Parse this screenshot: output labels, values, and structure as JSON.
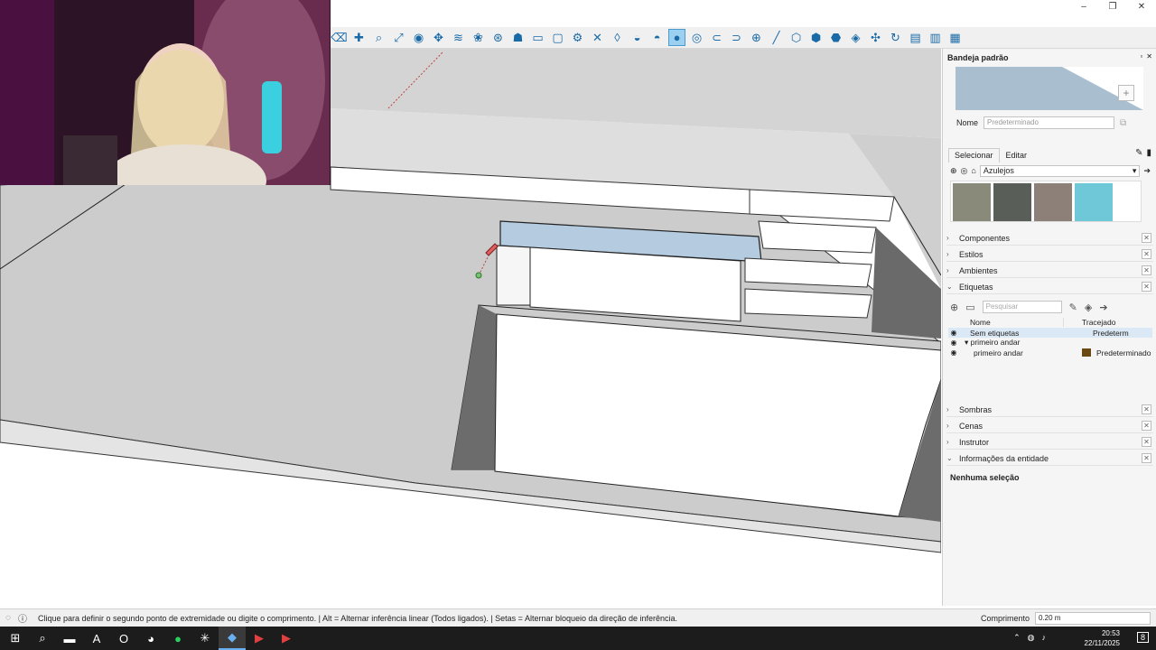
{
  "window": {
    "controls": [
      "–",
      "❐",
      "✕"
    ]
  },
  "toolbar": {
    "tools": [
      "eraser-icon",
      "paint-icon",
      "zoom-icon",
      "zoom-extents-icon",
      "orbit-icon",
      "pan-icon",
      "walk-icon",
      "look-icon",
      "section-icon",
      "component-icon",
      "select-icon",
      "rectangle-icon",
      "settings-icon",
      "close-icon",
      "fog-icon",
      "water-icon",
      "shadow-icon",
      "drop-icon",
      "style-icon",
      "magnet-icon",
      "magnet-active-icon",
      "add-icon",
      "line-icon",
      "cube-icon",
      "cube2-icon",
      "cube3-icon",
      "cube4-icon",
      "move-icon",
      "rotate-icon",
      "layer-icon",
      "layer2-icon",
      "layer3-icon"
    ],
    "active_tool": "drop-icon"
  },
  "panel": {
    "title": "Bandeja padrão",
    "name_label": "Nome",
    "name_placeholder": "Predeterminado",
    "tabs": [
      "Selecionar",
      "Editar"
    ],
    "library": "Azulejos",
    "swatches": [
      "#8a8a7a",
      "#5a5e58",
      "#8c8078",
      "#6fc8d8"
    ],
    "sections": [
      {
        "label": "Componentes",
        "expanded": false
      },
      {
        "label": "Estilos",
        "expanded": false
      },
      {
        "label": "Ambientes",
        "expanded": false
      },
      {
        "label": "Etiquetas",
        "expanded": true
      }
    ],
    "tags": {
      "search_placeholder": "Pesquisar",
      "col_name": "Nome",
      "col_dash": "Tracejado",
      "rows": [
        {
          "name": "Sem etiquetas",
          "dash": "Predeterm",
          "selected": true
        },
        {
          "name": "▾ primeiro andar",
          "dash": "",
          "selected": false
        },
        {
          "name": "primeiro andar",
          "dash": "Predeterminado",
          "selected": false
        }
      ]
    },
    "lower_sections": [
      {
        "label": "Sombras",
        "expanded": false
      },
      {
        "label": "Cenas",
        "expanded": false
      },
      {
        "label": "Instrutor",
        "expanded": false
      },
      {
        "label": "Informações da entidade",
        "expanded": true
      }
    ],
    "entity_info": "Nenhuma seleção"
  },
  "status": {
    "hint": "Clique para definir o segundo ponto de extremidade ou digite o comprimento. | Alt = Alternar inferência linear (Todos ligados). | Setas = Alternar bloqueio da direção de inferência.",
    "measure_label": "Comprimento",
    "measure_value": "0.20 m"
  },
  "taskbar": {
    "icons": [
      "windows-icon",
      "search-icon",
      "file-explorer-icon",
      "app-a-icon",
      "opera-icon",
      "discord-icon",
      "spotify-icon",
      "chatgpt-icon",
      "sketchup-icon",
      "app-red-icon",
      "app-red2-icon"
    ],
    "active": "sketchup-icon",
    "time": "20:53",
    "date": "22/11/2025",
    "notifications": "8"
  }
}
